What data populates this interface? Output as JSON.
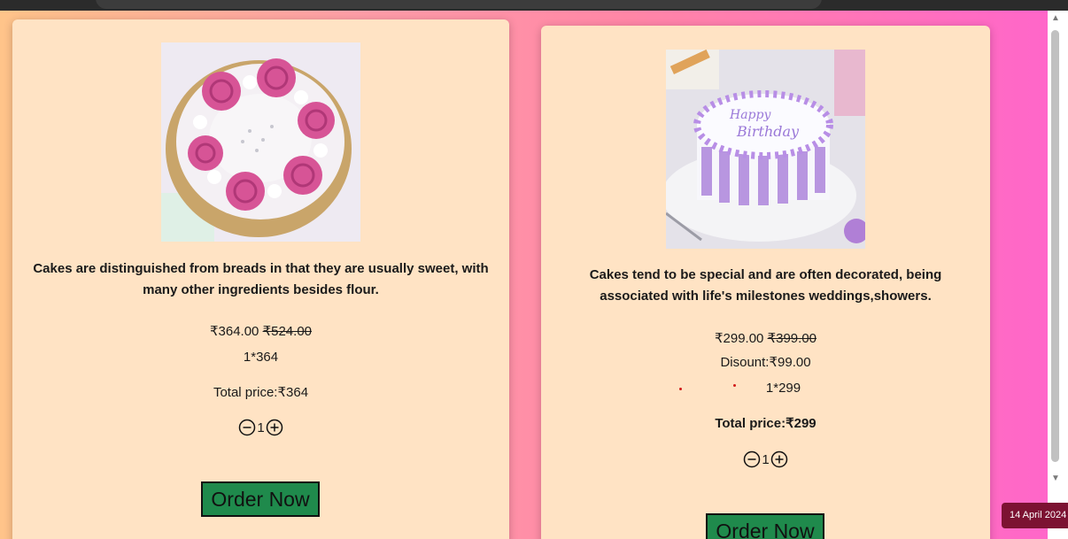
{
  "products": [
    {
      "description": "Cakes are distinguished from breads in that they are usually sweet, with many other ingredients besides flour.",
      "price": "₹364.00",
      "original_price": "₹524.00",
      "calc": "1*364",
      "total": "Total price:₹364",
      "quantity": "1",
      "order_label": "Order Now"
    },
    {
      "description": "Cakes tend to be special and are often decorated, being associated with life's milestones weddings,showers.",
      "price": "₹299.00",
      "original_price": "₹399.00",
      "discount": "Disount:₹99.00",
      "calc": "1*299",
      "total": "Total price:₹299",
      "quantity": "1",
      "order_label": "Order Now"
    }
  ],
  "date_badge": "14 April 2024",
  "colors": {
    "card_bg": "#ffe3c4",
    "button_bg": "#1f8a4c",
    "badge_bg": "#7c1232",
    "gradient_start": "#ffc48a",
    "gradient_end": "#ff66c9"
  },
  "icons": [
    "minus-circle-icon",
    "plus-circle-icon"
  ]
}
